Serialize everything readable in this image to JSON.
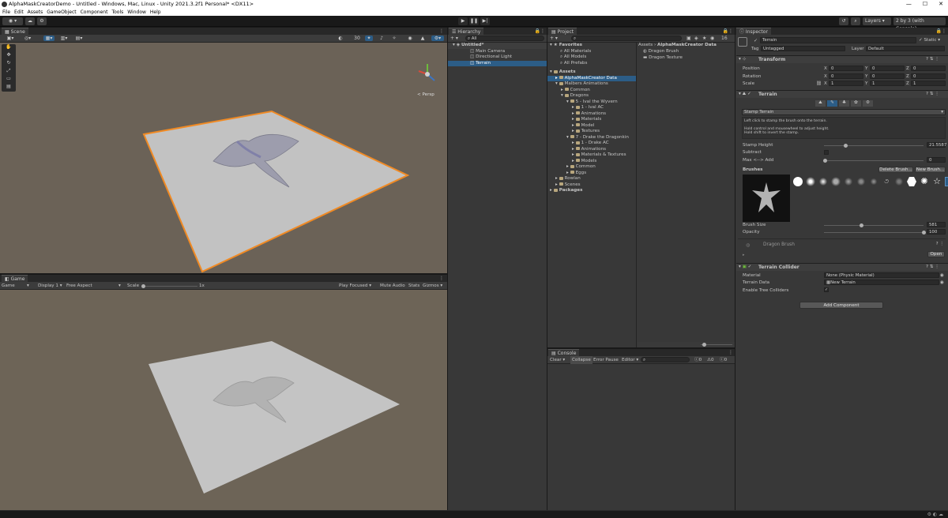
{
  "window": {
    "title": "AlphaMaskCreatorDemo - Untitled - Windows, Mac, Linux - Unity 2021.3.2f1 Personal* <DX11>",
    "minimize": "—",
    "maximize": "☐",
    "close": "✕"
  },
  "menu": [
    "File",
    "Edit",
    "Assets",
    "GameObject",
    "Component",
    "Tools",
    "Window",
    "Help"
  ],
  "toolbar": {
    "layers": "Layers",
    "layout": "2 by 3 (with Console)"
  },
  "scene": {
    "tab": "Scene",
    "persp": "< Persp",
    "count": "30"
  },
  "game": {
    "tab": "Game",
    "display_mode": "Game",
    "display": "Display 1",
    "aspect": "Free Aspect",
    "scale_label": "Scale",
    "scale_value": "1x",
    "play_focused": "Play Focused",
    "mute": "Mute Audio",
    "stats": "Stats",
    "gizmos": "Gizmos"
  },
  "hierarchy": {
    "tab": "Hierarchy",
    "search_placeholder": "All",
    "scene": "Untitled*",
    "items": [
      "Main Camera",
      "Directional Light",
      "Terrain"
    ]
  },
  "project": {
    "tab": "Project",
    "favorites": "Favorites",
    "fav_items": [
      "All Materials",
      "All Models",
      "All Prefabs"
    ],
    "badge": "16",
    "assets": "Assets",
    "tree": [
      {
        "label": "AlphaMaskCreator Data",
        "depth": 1,
        "selected": true
      },
      {
        "label": "Malbers Animations",
        "depth": 1
      },
      {
        "label": "Common",
        "depth": 2
      },
      {
        "label": "Dragons",
        "depth": 2
      },
      {
        "label": "5 - Ival the Wyvern",
        "depth": 3
      },
      {
        "label": "1 - Ival AC",
        "depth": 4
      },
      {
        "label": "Animations",
        "depth": 4
      },
      {
        "label": "Materials",
        "depth": 4
      },
      {
        "label": "Model",
        "depth": 4
      },
      {
        "label": "Textures",
        "depth": 4
      },
      {
        "label": "7 - Drake the Dragonkin",
        "depth": 3
      },
      {
        "label": "1 - Drake AC",
        "depth": 4
      },
      {
        "label": "Animations",
        "depth": 4
      },
      {
        "label": "Materials & Textures",
        "depth": 4
      },
      {
        "label": "Models",
        "depth": 4
      },
      {
        "label": "Common",
        "depth": 3
      },
      {
        "label": "Eggs",
        "depth": 3
      },
      {
        "label": "Rowlan",
        "depth": 1
      },
      {
        "label": "Scenes",
        "depth": 1
      }
    ],
    "packages": "Packages",
    "breadcrumb_root": "Assets",
    "breadcrumb_sep": "›",
    "breadcrumb_leaf": "AlphaMaskCreator Data",
    "files": [
      "Dragon Brush",
      "Dragon Texture"
    ]
  },
  "console": {
    "tab": "Console",
    "clear": "Clear",
    "collapse": "Collapse",
    "error_pause": "Error Pause",
    "editor": "Editor",
    "counts": [
      "0",
      "0",
      "0"
    ]
  },
  "inspector": {
    "tab": "Inspector",
    "object_name": "Terrain",
    "static": "Static",
    "tag_label": "Tag",
    "tag": "Untagged",
    "layer_label": "Layer",
    "layer": "Default",
    "transform": {
      "title": "Transform",
      "rows": [
        {
          "label": "Position",
          "x": "0",
          "y": "0",
          "z": "0"
        },
        {
          "label": "Rotation",
          "x": "0",
          "y": "0",
          "z": "0"
        },
        {
          "label": "Scale",
          "x": "1",
          "y": "1",
          "z": "1"
        }
      ]
    },
    "terrain": {
      "title": "Terrain",
      "tool": "Stamp Terrain",
      "help": [
        "Left click to stamp the brush onto the terrain.",
        "Hold control and mousewheel to adjust height.",
        "Hold shift to invert the stamp."
      ],
      "stamp_height_label": "Stamp Height",
      "stamp_height": "21.5587",
      "stamp_height_frac": 0.1,
      "subtract_label": "Subtract",
      "max_add_label": "Max <--> Add",
      "max_add": "0",
      "brushes_label": "Brushes",
      "delete_brush": "Delete Brush...",
      "new_brush": "New Brush...",
      "brush_size_label": "Brush Size",
      "brush_size": "581",
      "brush_size_frac": 0.38,
      "opacity_label": "Opacity",
      "opacity": "100",
      "opacity_frac": 1.0,
      "brush_name": "Dragon Brush",
      "open": "Open"
    },
    "collider": {
      "title": "Terrain Collider",
      "material_label": "Material",
      "material": "None (Physic Material)",
      "data_label": "Terrain Data",
      "data": "New Terrain",
      "trees_label": "Enable Tree Colliders",
      "trees": "✓"
    },
    "add_component": "Add Component"
  },
  "colors": {
    "accent": "#2c5d87",
    "selection_outline": "#f08a24",
    "ground": "#6b6257",
    "terrain": "#bdbdbd"
  }
}
